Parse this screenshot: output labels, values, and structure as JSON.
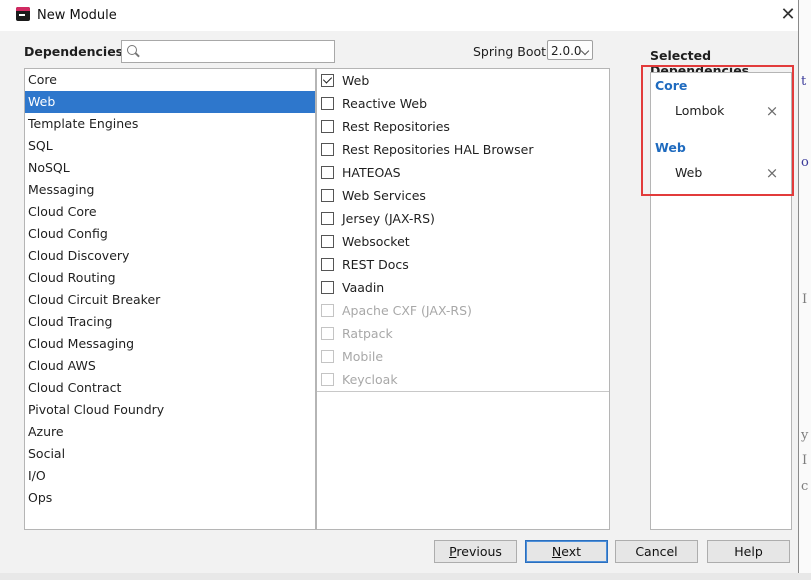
{
  "window": {
    "title": "New Module",
    "close_glyph": "✕"
  },
  "header": {
    "dependencies_label": "Dependencies",
    "search": {
      "value": "",
      "placeholder": ""
    },
    "spring_boot_label": "Spring Boot",
    "spring_boot_version": "2.0.0",
    "selected_label": "Selected Dependencies"
  },
  "categories": [
    {
      "label": "Core"
    },
    {
      "label": "Web",
      "selected": true
    },
    {
      "label": "Template Engines"
    },
    {
      "label": "SQL"
    },
    {
      "label": "NoSQL"
    },
    {
      "label": "Messaging"
    },
    {
      "label": "Cloud Core"
    },
    {
      "label": "Cloud Config"
    },
    {
      "label": "Cloud Discovery"
    },
    {
      "label": "Cloud Routing"
    },
    {
      "label": "Cloud Circuit Breaker"
    },
    {
      "label": "Cloud Tracing"
    },
    {
      "label": "Cloud Messaging"
    },
    {
      "label": "Cloud AWS"
    },
    {
      "label": "Cloud Contract"
    },
    {
      "label": "Pivotal Cloud Foundry"
    },
    {
      "label": "Azure"
    },
    {
      "label": "Social"
    },
    {
      "label": "I/O"
    },
    {
      "label": "Ops"
    }
  ],
  "dependencies": [
    {
      "label": "Web",
      "checked": true,
      "enabled": true
    },
    {
      "label": "Reactive Web",
      "checked": false,
      "enabled": true
    },
    {
      "label": "Rest Repositories",
      "checked": false,
      "enabled": true
    },
    {
      "label": "Rest Repositories HAL Browser",
      "checked": false,
      "enabled": true
    },
    {
      "label": "HATEOAS",
      "checked": false,
      "enabled": true
    },
    {
      "label": "Web Services",
      "checked": false,
      "enabled": true
    },
    {
      "label": "Jersey (JAX-RS)",
      "checked": false,
      "enabled": true
    },
    {
      "label": "Websocket",
      "checked": false,
      "enabled": true
    },
    {
      "label": "REST Docs",
      "checked": false,
      "enabled": true
    },
    {
      "label": "Vaadin",
      "checked": false,
      "enabled": true
    },
    {
      "label": "Apache CXF (JAX-RS)",
      "checked": false,
      "enabled": false
    },
    {
      "label": "Ratpack",
      "checked": false,
      "enabled": false
    },
    {
      "label": "Mobile",
      "checked": false,
      "enabled": false
    },
    {
      "label": "Keycloak",
      "checked": false,
      "enabled": false
    }
  ],
  "selected_groups": [
    {
      "title": "Core",
      "items": [
        {
          "label": "Lombok",
          "remove_glyph": "×"
        }
      ]
    },
    {
      "title": "Web",
      "items": [
        {
          "label": "Web",
          "remove_glyph": "×"
        }
      ]
    }
  ],
  "buttons": {
    "previous": {
      "mnemonic": "P",
      "rest": "revious"
    },
    "next": {
      "mnemonic": "N",
      "rest": "ext"
    },
    "cancel": "Cancel",
    "help": "Help"
  },
  "colors": {
    "selection": "#2e77cc",
    "group_title": "#1f6bbf",
    "highlight_box": "#e23b3b"
  },
  "icons": {
    "app": "intellij-app-icon",
    "search": "search-icon",
    "dropdown": "chevron-down-icon",
    "remove": "close-icon"
  }
}
